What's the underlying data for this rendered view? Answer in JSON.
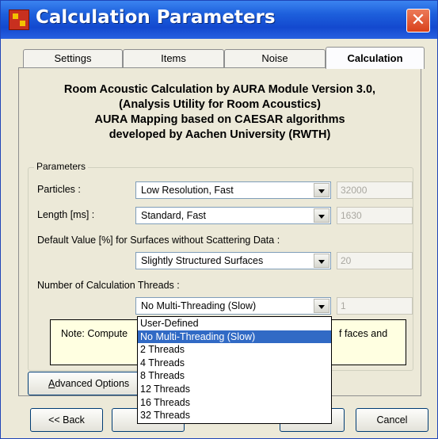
{
  "window": {
    "title": "Calculation Parameters",
    "close_glyph": "✕"
  },
  "tabs": [
    {
      "label": "Settings",
      "active": false
    },
    {
      "label": "Items",
      "active": false
    },
    {
      "label": "Noise",
      "active": false
    },
    {
      "label": "Calculation",
      "active": true
    }
  ],
  "heading": {
    "line1": "Room Acoustic Calculation by AURA Module Version 3.0,",
    "line2": "(Analysis Utility for Room Acoustics)",
    "line3": "AURA Mapping based on CAESAR algorithms",
    "line4": "developed by Aachen University (RWTH)"
  },
  "parameters": {
    "group_label": "Parameters",
    "particles": {
      "label": "Particles :",
      "value": "Low Resolution, Fast",
      "number": "32000"
    },
    "length": {
      "label": "Length [ms] :",
      "value": "Standard, Fast",
      "number": "1630"
    },
    "default_value": {
      "label": "Default Value [%] for Surfaces without Scattering Data :",
      "value": "Slightly Structured Surfaces",
      "number": "20"
    },
    "threads": {
      "label": "Number of Calculation Threads :",
      "value": "No Multi-Threading (Slow)",
      "number": "1"
    }
  },
  "note": {
    "text_left": "Note: Compute",
    "text_right": "f faces and"
  },
  "threads_dropdown": {
    "options": [
      "User-Defined",
      "No Multi-Threading (Slow)",
      "2 Threads",
      "4 Threads",
      "8 Threads",
      "12 Threads",
      "16 Threads",
      "32 Threads"
    ],
    "selected": "No Multi-Threading (Slow)"
  },
  "buttons": {
    "advanced_options": "Advanced Options",
    "advanced_options_mnemonic": "A",
    "advanced_options_rest": "dvanced Options",
    "back": "<< Back",
    "cancel": "Cancel"
  },
  "colors": {
    "title_bar": "#1d5fdc",
    "selection": "#316ac5",
    "note_background": "#ffffe1",
    "close_button": "#d9411b"
  }
}
